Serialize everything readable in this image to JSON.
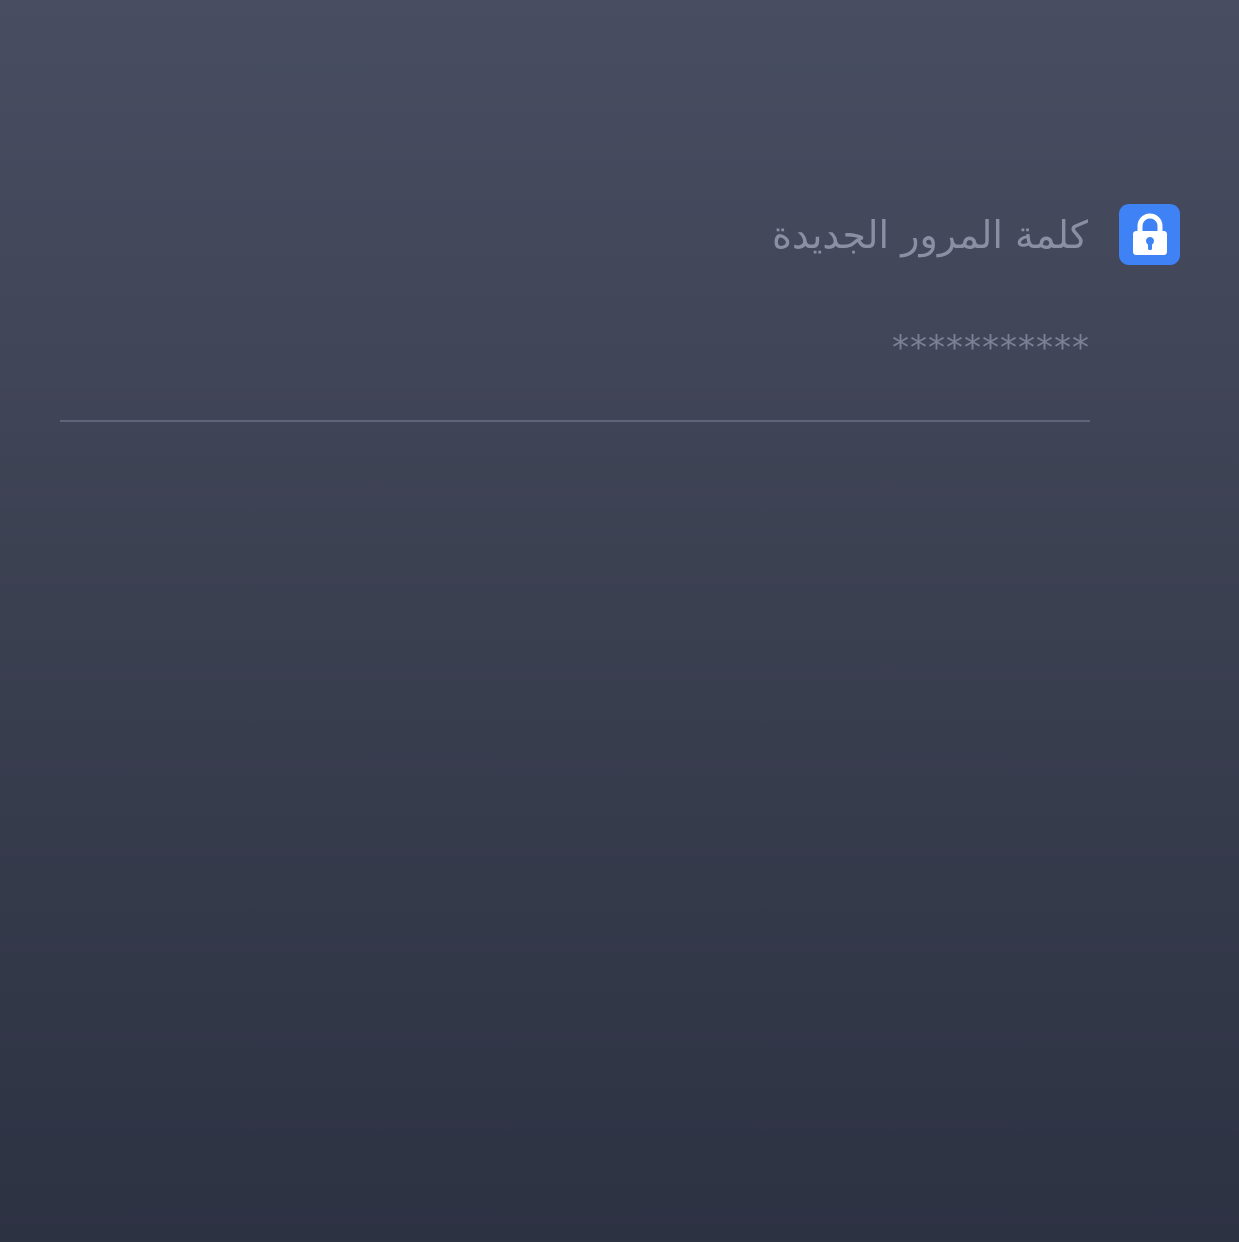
{
  "password_field": {
    "label": "كلمة المرور الجديدة",
    "placeholder": "***********",
    "value": "",
    "icon": "lock-icon",
    "accent_color": "#3f82f6"
  }
}
